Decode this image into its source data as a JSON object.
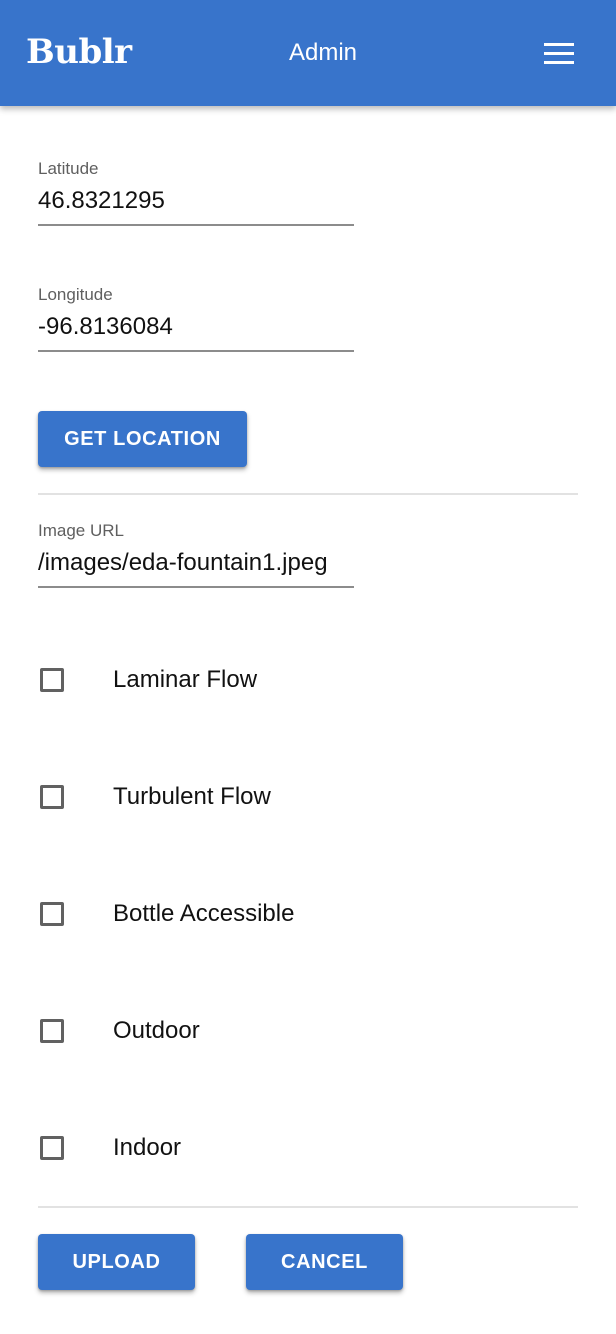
{
  "header": {
    "brand": "Bublr",
    "title": "Admin",
    "menu_icon": "hamburger-menu-icon"
  },
  "location": {
    "latitude_label": "Latitude",
    "latitude_value": "46.8321295",
    "longitude_label": "Longitude",
    "longitude_value": "-96.8136084",
    "get_location_label": "Get Location"
  },
  "image": {
    "label": "Image URL",
    "value": "/images/eda-fountain1.jpeg"
  },
  "features": [
    {
      "label": "Laminar Flow",
      "checked": false
    },
    {
      "label": "Turbulent Flow",
      "checked": false
    },
    {
      "label": "Bottle Accessible",
      "checked": false
    },
    {
      "label": "Outdoor",
      "checked": false
    },
    {
      "label": "Indoor",
      "checked": false
    }
  ],
  "actions": {
    "upload_label": "Upload",
    "cancel_label": "Cancel"
  },
  "colors": {
    "primary": "#3874cb",
    "on_primary": "#ffffff",
    "divider": "#e2e2e2"
  }
}
